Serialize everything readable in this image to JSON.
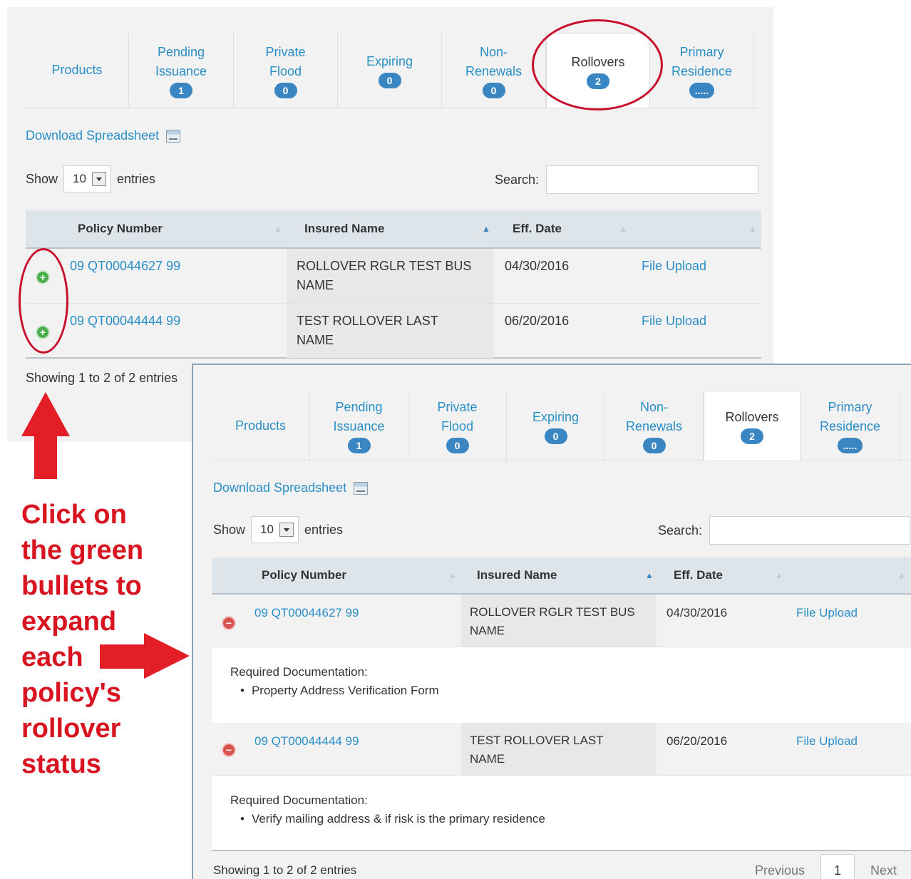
{
  "tabs": [
    {
      "line1": "Products",
      "line2": "",
      "badge": ""
    },
    {
      "line1": "Pending",
      "line2": "Issuance",
      "badge": "1"
    },
    {
      "line1": "Private",
      "line2": "Flood",
      "badge": "0"
    },
    {
      "line1": "Expiring",
      "line2": "",
      "badge": "0"
    },
    {
      "line1": "Non-",
      "line2": "Renewals",
      "badge": "0"
    },
    {
      "line1": "Rollovers",
      "line2": "",
      "badge": "2"
    },
    {
      "line1": "Primary",
      "line2": "Residence",
      "badge": "....."
    }
  ],
  "download_label": "Download Spreadsheet",
  "show_label": "Show",
  "entries_value": "10",
  "entries_label": "entries",
  "search_label": "Search:",
  "columns": [
    "Policy Number",
    "Insured Name",
    "Eff. Date"
  ],
  "rows": [
    {
      "policy": "09 QT00044627 99",
      "insured_line1": "ROLLOVER RGLR TEST BUS",
      "insured_line2": "NAME",
      "eff_date": "04/30/2016",
      "action": "File Upload",
      "required_label": "Required Documentation:",
      "required_item": "Property Address Verification Form"
    },
    {
      "policy": "09 QT00044444 99",
      "insured_line1": "TEST ROLLOVER LAST",
      "insured_line2": "NAME",
      "eff_date": "06/20/2016",
      "action": "File Upload",
      "required_label": "Required Documentation:",
      "required_item": "Verify mailing address & if risk is the primary residence"
    }
  ],
  "showing_text": "Showing 1 to 2 of 2 entries",
  "pager": {
    "previous": "Previous",
    "page": "1",
    "next": "Next"
  },
  "instruction_lines": [
    "Click on",
    "the green",
    "bullets to",
    "expand",
    "each",
    "policy's",
    "rollover",
    "status"
  ],
  "colors": {
    "link": "#2a8fc7",
    "badge": "#3a86c2",
    "annotation_red": "#e41e26",
    "expand_green": "#4cae4c",
    "collapse_red": "#d9534f"
  }
}
